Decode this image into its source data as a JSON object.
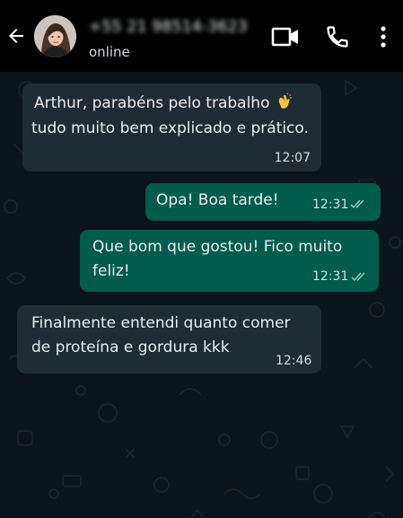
{
  "header": {
    "contact_name": "+55 21 98514-3623",
    "status": "online",
    "icons": [
      "back-arrow-icon",
      "avatar",
      "video-call-icon",
      "phone-call-icon",
      "more-options-icon"
    ]
  },
  "messages": [
    {
      "direction": "incoming",
      "line1": "Arthur, parabéns pelo trabalho",
      "emoji": "clapping-hands-icon",
      "line2": "tudo muito bem explicado e prático.",
      "time": "12:07"
    },
    {
      "direction": "outgoing",
      "text": "Opa! Boa tarde!",
      "time": "12:31",
      "status": "read"
    },
    {
      "direction": "outgoing",
      "text": "Que bom que gostou! Fico muito\nfeliz!",
      "time": "12:31",
      "status": "read"
    },
    {
      "direction": "incoming",
      "text": "Finalmente entendi quanto comer\nde proteína e gordura kkk",
      "time": "12:46"
    }
  ],
  "colors": {
    "header_bg": "#000000",
    "chat_bg": "#0b141a",
    "incoming_bubble": "#202c33",
    "outgoing_bubble": "#005c4b",
    "text": "#e9edef"
  }
}
